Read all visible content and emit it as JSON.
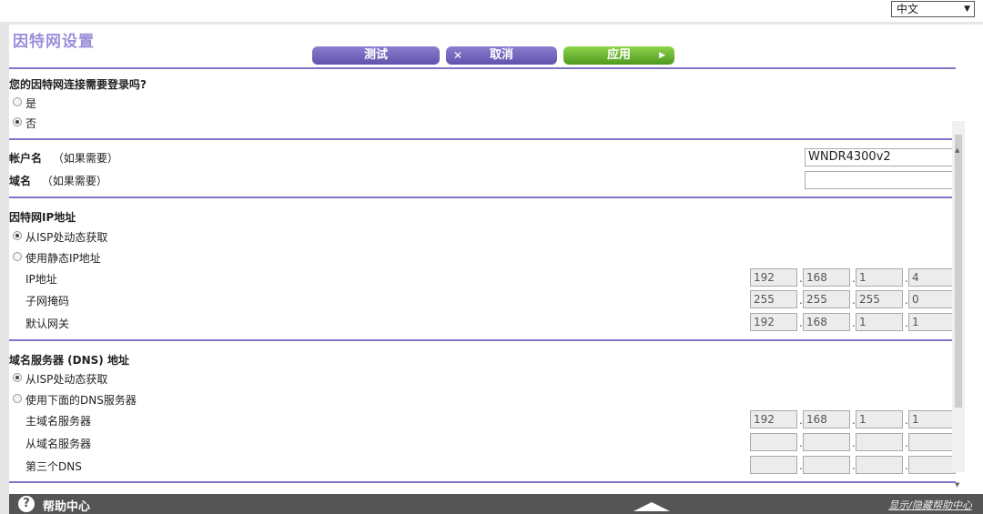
{
  "language": {
    "selected": "中文"
  },
  "page": {
    "title": "因特网设置"
  },
  "buttons": {
    "test": "测试",
    "cancel": "取消",
    "apply": "应用"
  },
  "login_section": {
    "question": "您的因特网连接需要登录吗?",
    "options": [
      {
        "label": "是",
        "selected": false
      },
      {
        "label": "否",
        "selected": true
      }
    ]
  },
  "account": {
    "account_label": "帐户名",
    "account_hint": "（如果需要）",
    "account_value": "WNDR4300v2",
    "domain_label": "域名",
    "domain_hint": "（如果需要）",
    "domain_value": ""
  },
  "ip_section": {
    "title": "因特网IP地址",
    "options": [
      {
        "label": "从ISP处动态获取",
        "selected": true
      },
      {
        "label": "使用静态IP地址",
        "selected": false
      }
    ],
    "rows": [
      {
        "label": "IP地址",
        "octets": [
          "192",
          "168",
          "1",
          "4"
        ]
      },
      {
        "label": "子网掩码",
        "octets": [
          "255",
          "255",
          "255",
          "0"
        ]
      },
      {
        "label": "默认网关",
        "octets": [
          "192",
          "168",
          "1",
          "1"
        ]
      }
    ]
  },
  "dns_section": {
    "title": "域名服务器 (DNS) 地址",
    "options": [
      {
        "label": "从ISP处动态获取",
        "selected": true
      },
      {
        "label": "使用下面的DNS服务器",
        "selected": false
      }
    ],
    "rows": [
      {
        "label": "主域名服务器",
        "octets": [
          "192",
          "168",
          "1",
          "1"
        ]
      },
      {
        "label": "从域名服务器",
        "octets": [
          "",
          "",
          "",
          ""
        ]
      },
      {
        "label": "第三个DNS",
        "octets": [
          "",
          "",
          "",
          ""
        ]
      }
    ]
  },
  "footer": {
    "help_title": "帮助中心",
    "toggle_help": "显示/隐藏帮助中心"
  },
  "colors": {
    "accent": "#7f74c6",
    "title": "#9b8fd9",
    "apply": "#5fae2a",
    "footer": "#555555"
  }
}
